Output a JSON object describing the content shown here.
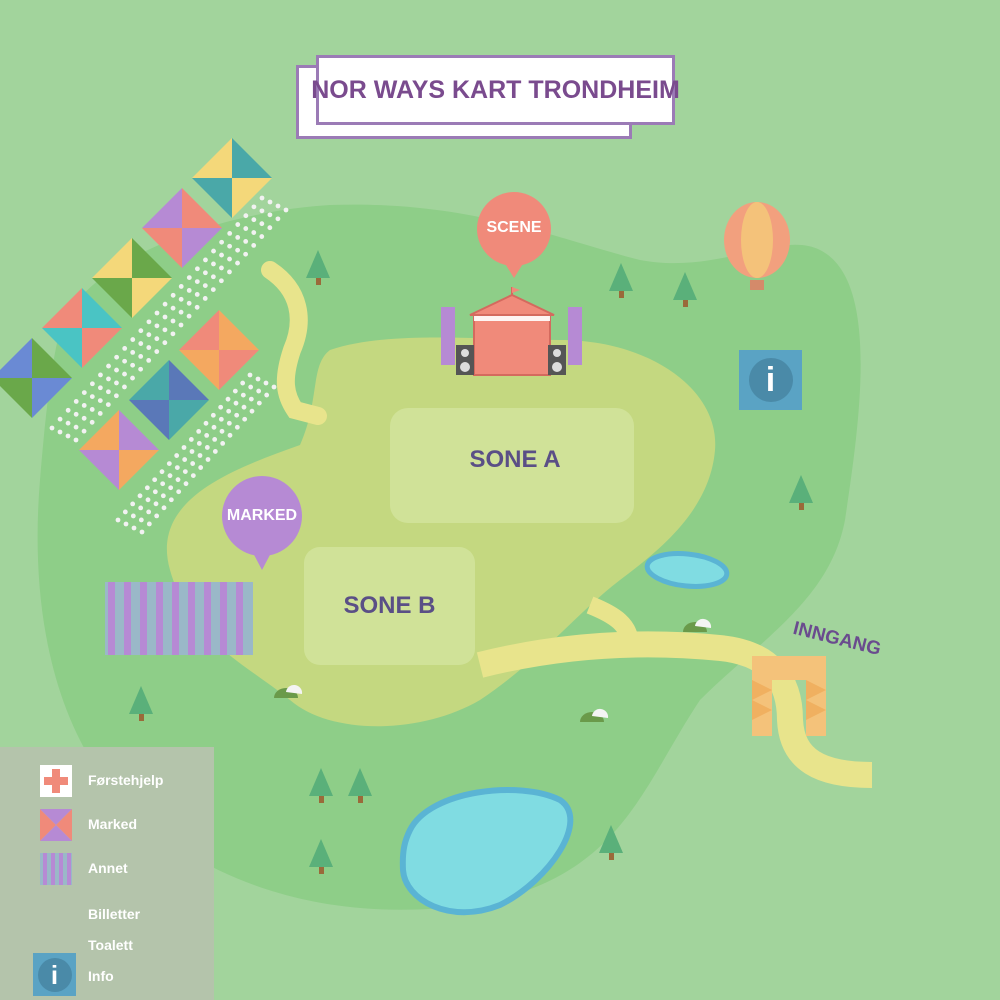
{
  "title": "NOR WAYS KART TRONDHEIM",
  "zones": {
    "sone_a": "SONE A",
    "sone_b": "SONE B"
  },
  "pins": {
    "scene": "SCENE",
    "marked": "MARKED"
  },
  "entrance": "INNGANG",
  "info_icon_glyph": "i",
  "legend": {
    "items": [
      {
        "label": "Førstehjelp",
        "icon": "first-aid-icon"
      },
      {
        "label": "Marked",
        "icon": "market-tent-icon"
      },
      {
        "label": "Annet",
        "icon": "striped-area-icon"
      },
      {
        "label": "Billetter",
        "icon": ""
      },
      {
        "label": "Toalett",
        "icon": ""
      },
      {
        "label": "Info",
        "icon": "info-icon"
      }
    ]
  },
  "colors": {
    "background": "#a2d49c",
    "park": "#8ece88",
    "field": "#c4d880",
    "zone": "#d0e298",
    "path": "#e8e48c",
    "water": "#80dce2",
    "water_border": "#5ab4d4",
    "title_border": "#9b7bb6",
    "title_text": "#7a4b8e",
    "scene_pin": "#f08a7a",
    "market_pin": "#b68ad4",
    "info": "#5aa3c4"
  }
}
